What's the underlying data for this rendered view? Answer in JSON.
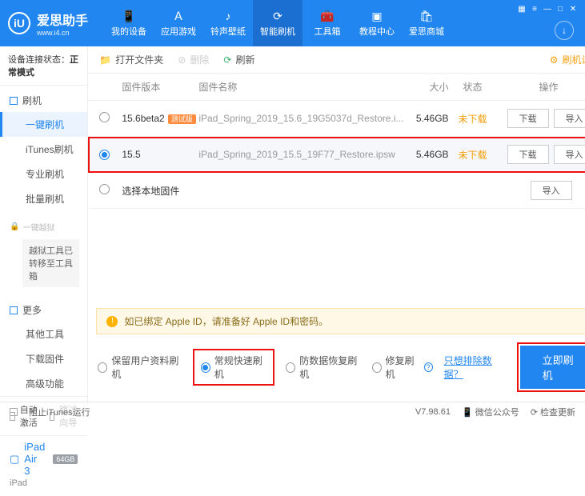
{
  "brand": {
    "name": "爱思助手",
    "url": "www.i4.cn",
    "logo_letter": "iU"
  },
  "nav": {
    "items": [
      {
        "label": "我的设备",
        "icon": "📱"
      },
      {
        "label": "应用游戏",
        "icon": "Ａ"
      },
      {
        "label": "铃声壁纸",
        "icon": "♪"
      },
      {
        "label": "智能刷机",
        "icon": "⟳"
      },
      {
        "label": "工具箱",
        "icon": "🧰"
      },
      {
        "label": "教程中心",
        "icon": "▣"
      },
      {
        "label": "爱思商城",
        "icon": "🛍"
      }
    ],
    "active_index": 3
  },
  "sidebar": {
    "status_label": "设备连接状态：",
    "status_value": "正常模式",
    "groups": {
      "flash_head": "刷机",
      "flash_items": [
        "一键刷机",
        "iTunes刷机",
        "专业刷机",
        "批量刷机"
      ],
      "flash_active": 0,
      "jailbreak_head": "一键越狱",
      "jailbreak_note": "越狱工具已转移至工具箱",
      "more_head": "更多",
      "more_items": [
        "其他工具",
        "下载固件",
        "高级功能"
      ]
    },
    "auto_activate": "自动激活",
    "skip_guide": "跳过向导",
    "device": {
      "name": "iPad Air 3",
      "storage": "64GB",
      "type": "iPad"
    }
  },
  "toolbar": {
    "open_folder": "打开文件夹",
    "delete": "删除",
    "refresh": "刷新",
    "settings": "刷机设置"
  },
  "table": {
    "headers": {
      "version": "固件版本",
      "name": "固件名称",
      "size": "大小",
      "state": "状态",
      "ops": "操作"
    },
    "rows": [
      {
        "version": "15.6beta2",
        "tag": "测试版",
        "name": "iPad_Spring_2019_15.6_19G5037d_Restore.i...",
        "size": "5.46GB",
        "state": "未下载",
        "selected": false
      },
      {
        "version": "15.5",
        "tag": "",
        "name": "iPad_Spring_2019_15.5_19F77_Restore.ipsw",
        "size": "5.46GB",
        "state": "未下载",
        "selected": true
      }
    ],
    "local_row": "选择本地固件",
    "btn_download": "下载",
    "btn_import": "导入"
  },
  "notice": {
    "text": "如已绑定 Apple ID，请准备好 Apple ID和密码。"
  },
  "options": {
    "o1": "保留用户资料刷机",
    "o2": "常规快速刷机",
    "o3": "防数据恢复刷机",
    "o4": "修复刷机",
    "exclude_link": "只想排除数据？",
    "primary": "立即刷机"
  },
  "footer": {
    "block_itunes": "阻止iTunes运行",
    "version": "V7.98.61",
    "wechat": "微信公众号",
    "check_update": "检查更新"
  }
}
